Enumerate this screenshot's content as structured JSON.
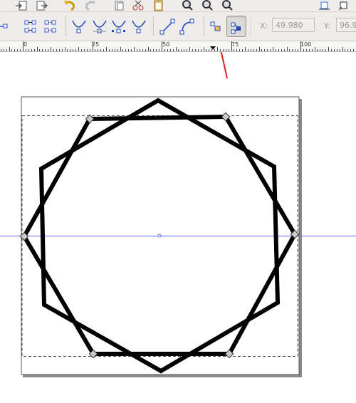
{
  "toolbar": {
    "row1_icons": [
      "import-icon",
      "export-icon",
      "undo-icon",
      "redo-icon",
      "copy-icon",
      "cut-icon",
      "paste-icon",
      "zoom-selection-icon",
      "zoom-drawing-icon",
      "zoom-page-icon",
      "align-icon",
      "transform-icon"
    ],
    "node_tools": [
      "insert-node-icon",
      "join-nodes-icon",
      "break-path-icon",
      "node-cusp-icon",
      "node-smooth-icon",
      "node-symmetric-icon",
      "node-auto-icon",
      "segment-line-icon",
      "segment-curve-icon",
      "object-to-path-icon",
      "show-handles-icon"
    ],
    "x_label": "X:",
    "x_value": "49.980",
    "y_label": "Y:",
    "y_value": "96.9",
    "accent": "#3366cc"
  },
  "ruler": {
    "labels": [
      "0",
      "25",
      "50",
      "75",
      "100"
    ]
  },
  "canvas": {
    "page_color": "#ffffff",
    "guide_color": "#5a6cf0",
    "shape_stroke": "#000000",
    "annotation_arrow_color": "#e02020"
  }
}
